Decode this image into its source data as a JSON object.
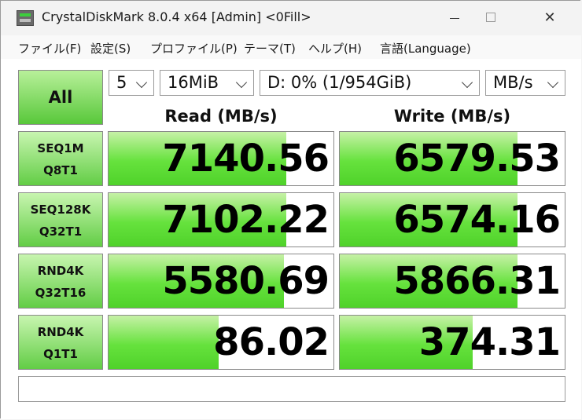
{
  "window": {
    "title": "CrystalDiskMark 8.0.4 x64 [Admin] <0Fill>",
    "controls": {
      "minimize": "minimize",
      "maximize": "maximize",
      "close": "✕"
    }
  },
  "menu": [
    "ファイル(F)",
    "設定(S)",
    "プロファイル(P)",
    "テーマ(T)",
    "ヘルプ(H)",
    "言語(Language)"
  ],
  "toolbar": {
    "all_label": "All",
    "count": "5",
    "size": "16MiB",
    "drive": "D: 0% (1/954GiB)",
    "unit": "MB/s"
  },
  "headers": {
    "read": "Read (MB/s)",
    "write": "Write (MB/s)"
  },
  "rows": [
    {
      "line1": "SEQ1M",
      "line2": "Q8T1",
      "read": "7140.56",
      "write": "6579.53",
      "read_fill": 0.79,
      "write_fill": 0.79
    },
    {
      "line1": "SEQ128K",
      "line2": "Q32T1",
      "read": "7102.22",
      "write": "6574.16",
      "read_fill": 0.79,
      "write_fill": 0.79
    },
    {
      "line1": "RND4K",
      "line2": "Q32T16",
      "read": "5580.69",
      "write": "5866.31",
      "read_fill": 0.78,
      "write_fill": 0.79
    },
    {
      "line1": "RND4K",
      "line2": "Q1T1",
      "read": "86.02",
      "write": "374.31",
      "read_fill": 0.49,
      "write_fill": 0.59
    }
  ],
  "comment": ""
}
